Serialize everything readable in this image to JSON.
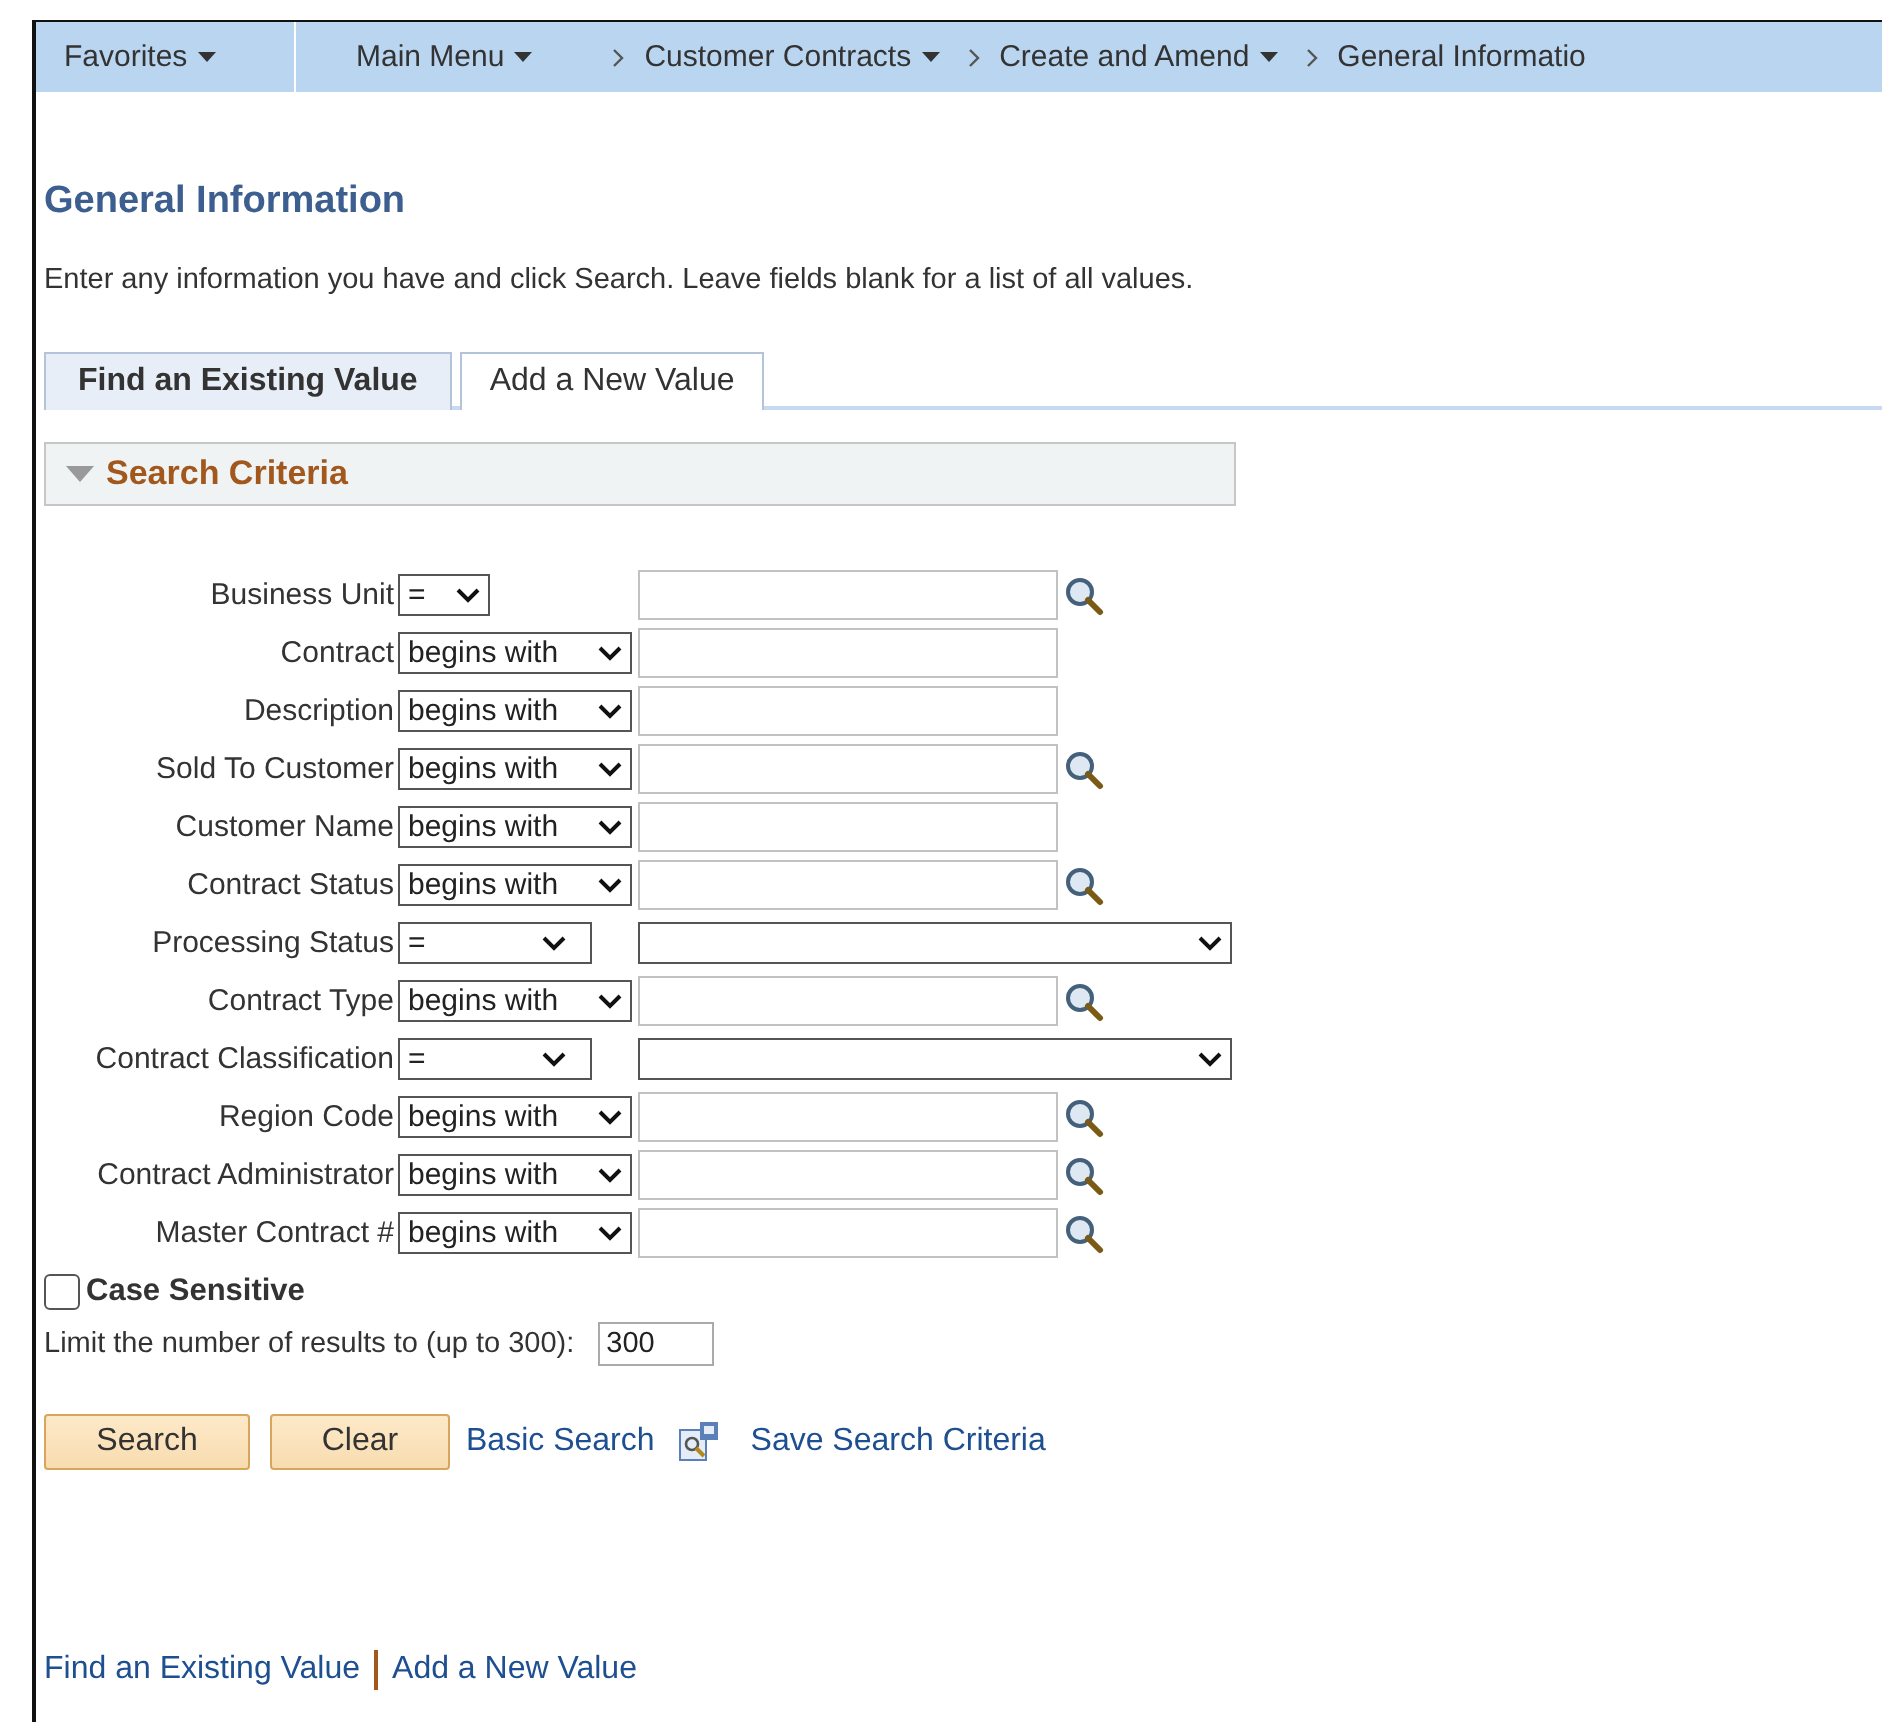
{
  "nav": [
    {
      "label": "Favorites",
      "menu": true,
      "kind": "start"
    },
    {
      "label": "Main Menu",
      "menu": true,
      "kind": "start"
    },
    {
      "label": "Customer Contracts",
      "menu": true,
      "kind": "crumb"
    },
    {
      "label": "Create and Amend",
      "menu": true,
      "kind": "crumb"
    },
    {
      "label": "General Informatio",
      "menu": false,
      "kind": "crumb"
    }
  ],
  "page_title": "General Information",
  "instructions": "Enter any information you have and click Search. Leave fields blank for a list of all values.",
  "tabs": [
    {
      "label": "Find an Existing Value",
      "selected": true
    },
    {
      "label": "Add a New Value",
      "selected": false
    }
  ],
  "section": {
    "title": "Search Criteria",
    "expanded": true
  },
  "criteria": [
    {
      "label": "Business Unit",
      "operator": "=",
      "kind": "text",
      "lookup": true
    },
    {
      "label": "Contract",
      "operator": "begins with",
      "kind": "text",
      "lookup": false
    },
    {
      "label": "Description",
      "operator": "begins with",
      "kind": "text",
      "lookup": false
    },
    {
      "label": "Sold To Customer",
      "operator": "begins with",
      "kind": "text",
      "lookup": true
    },
    {
      "label": "Customer Name",
      "operator": "begins with",
      "kind": "text",
      "lookup": false
    },
    {
      "label": "Contract Status",
      "operator": "begins with",
      "kind": "text",
      "lookup": true
    },
    {
      "label": "Processing Status",
      "operator": "=",
      "kind": "dropdown",
      "lookup": false
    },
    {
      "label": "Contract Type",
      "operator": "begins with",
      "kind": "text",
      "lookup": true
    },
    {
      "label": "Contract Classification",
      "operator": "=",
      "kind": "dropdown",
      "lookup": false
    },
    {
      "label": "Region Code",
      "operator": "begins with",
      "kind": "text",
      "lookup": true
    },
    {
      "label": "Contract Administrator",
      "operator": "begins with",
      "kind": "text",
      "lookup": true
    },
    {
      "label": "Master Contract #",
      "operator": "begins with",
      "kind": "text",
      "lookup": true
    }
  ],
  "case_sensitive": {
    "label": "Case Sensitive",
    "checked": false
  },
  "limit": {
    "label": "Limit the number of results to (up to 300):",
    "value": "300"
  },
  "buttons": [
    "Search",
    "Clear"
  ],
  "links": [
    "Basic Search",
    "Save Search Criteria"
  ],
  "footer_links": [
    "Find an Existing Value",
    "Add a New Value"
  ]
}
